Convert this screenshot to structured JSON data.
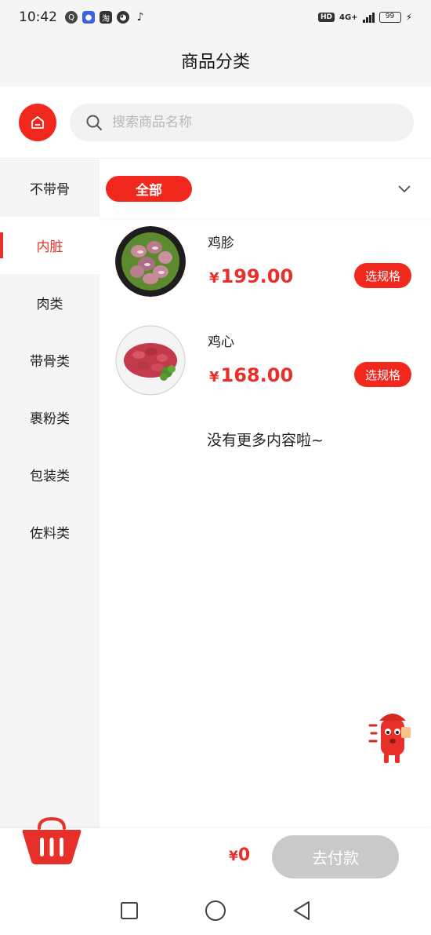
{
  "status_bar": {
    "time": "10:42",
    "network": "4G+",
    "battery": "99"
  },
  "header": {
    "title": "商品分类"
  },
  "search": {
    "placeholder": "搜索商品名称"
  },
  "sidebar": {
    "items": [
      {
        "label": "不带骨",
        "active": false
      },
      {
        "label": "内脏",
        "active": true
      },
      {
        "label": "肉类",
        "active": false
      },
      {
        "label": "带骨类",
        "active": false
      },
      {
        "label": "裹粉类",
        "active": false
      },
      {
        "label": "包装类",
        "active": false
      },
      {
        "label": "佐料类",
        "active": false
      }
    ]
  },
  "filter": {
    "selected": "全部"
  },
  "products": [
    {
      "name": "鸡胗",
      "currency": "¥",
      "price": "199.00",
      "button": "选规格"
    },
    {
      "name": "鸡心",
      "currency": "¥",
      "price": "168.00",
      "button": "选规格"
    }
  ],
  "list_end_text": "没有更多内容啦~",
  "cart": {
    "currency": "¥",
    "total": "0",
    "pay_label": "去付款"
  },
  "colors": {
    "accent": "#f0281e",
    "price": "#e8302a",
    "disabled": "#c9c9c9"
  }
}
